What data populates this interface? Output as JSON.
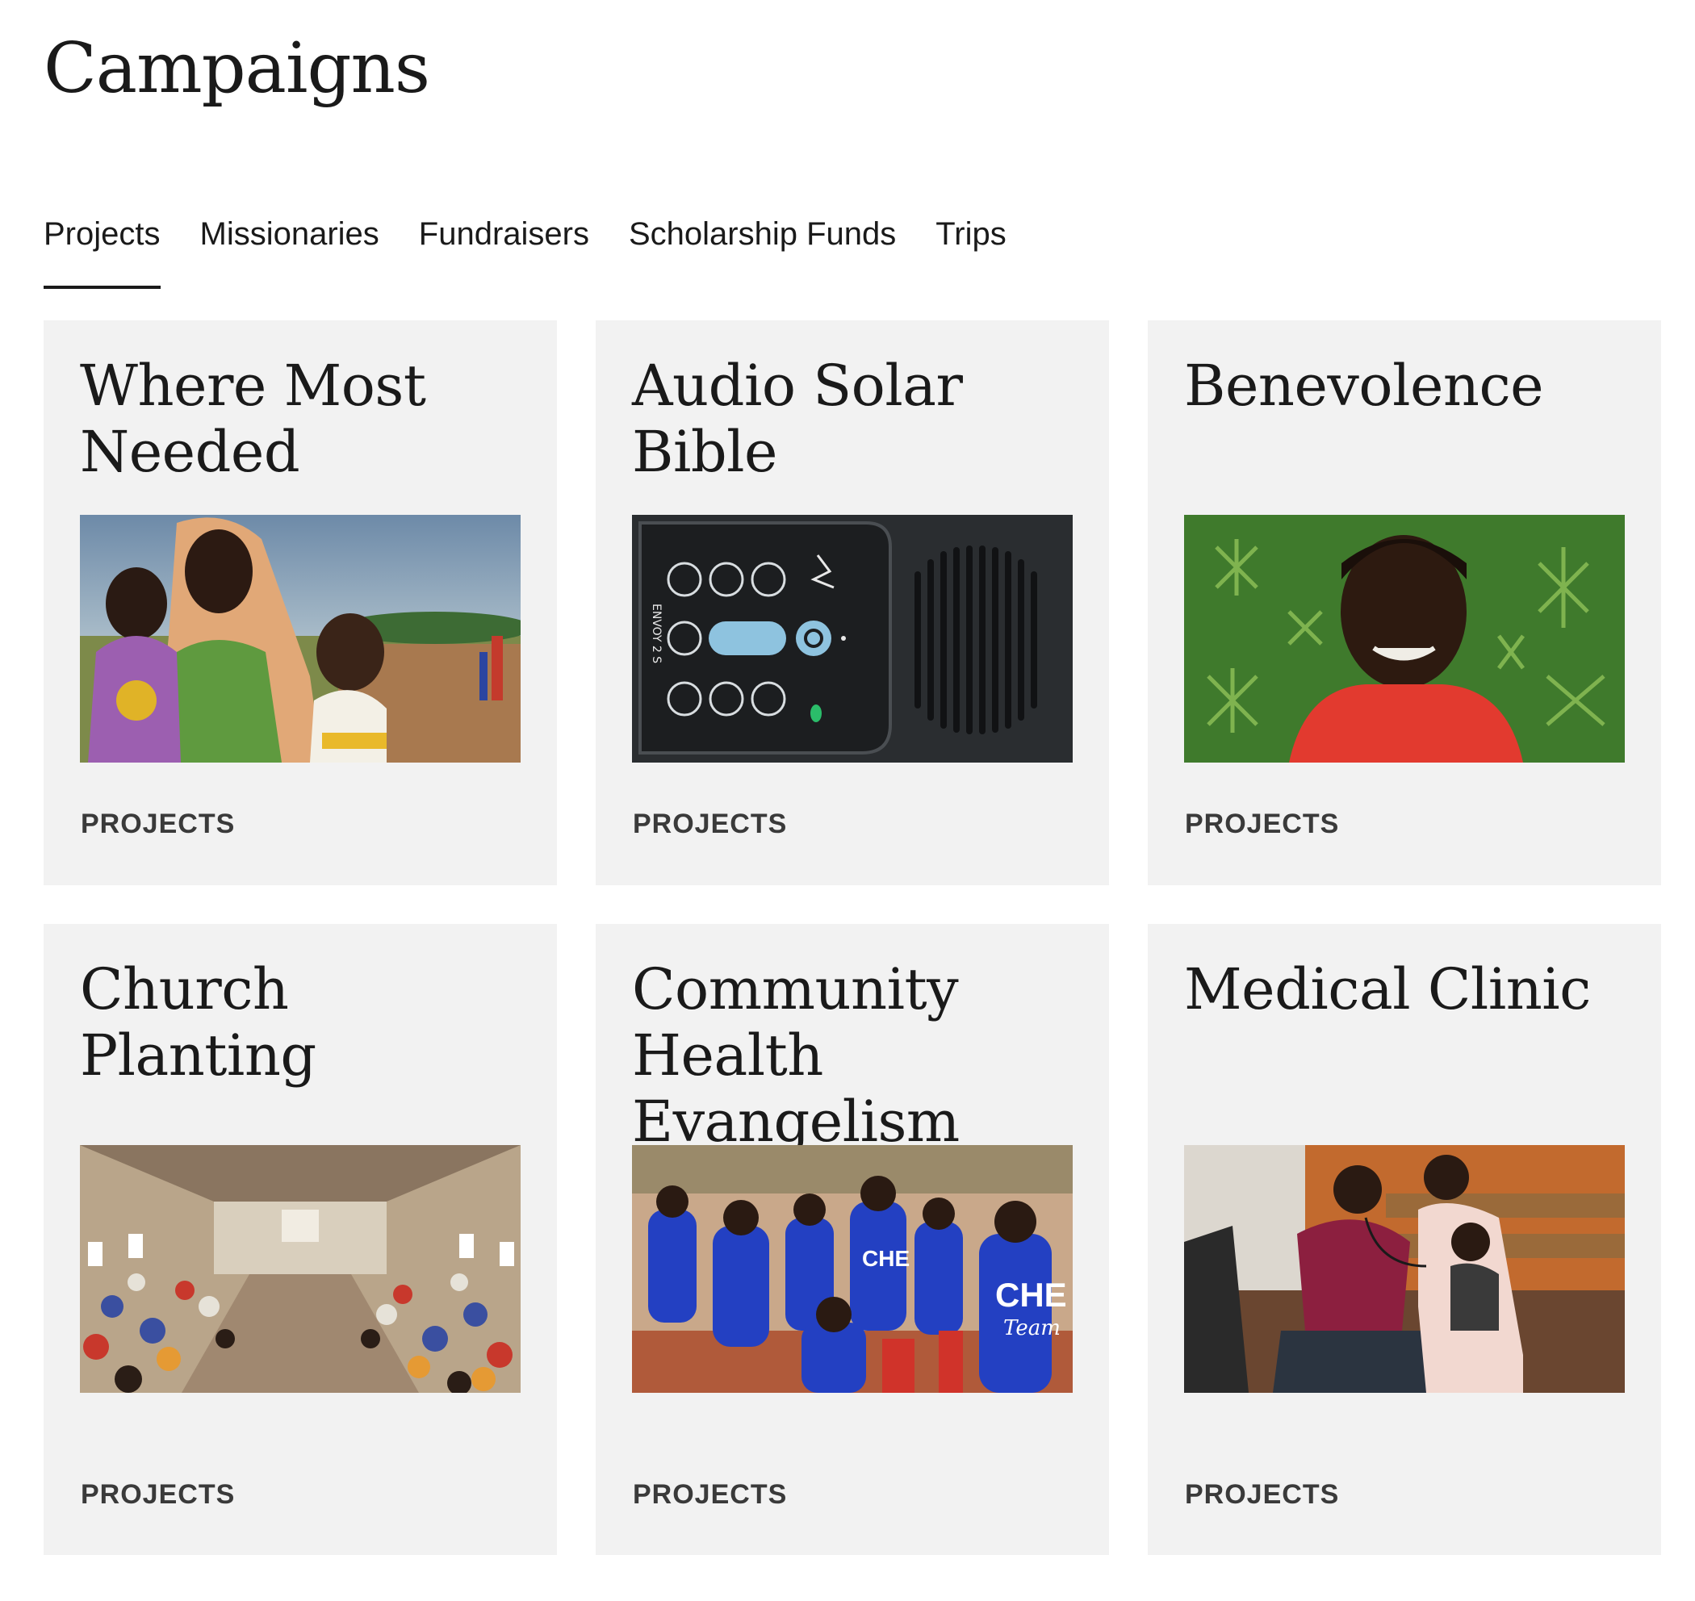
{
  "page": {
    "title": "Campaigns"
  },
  "tabs": [
    {
      "label": "Projects",
      "active": true
    },
    {
      "label": "Missionaries",
      "active": false
    },
    {
      "label": "Fundraisers",
      "active": false
    },
    {
      "label": "Scholarship Funds",
      "active": false
    },
    {
      "label": "Trips",
      "active": false
    }
  ],
  "cards": [
    {
      "title": "Where Most Needed",
      "tag": "PROJECTS",
      "image": "photo-woman-with-two-children"
    },
    {
      "title": "Audio Solar Bible",
      "tag": "PROJECTS",
      "image": "photo-audio-bible-device",
      "device_label": "ENVOY 2 S"
    },
    {
      "title": "Benevolence",
      "tag": "PROJECTS",
      "image": "photo-smiling-child-red-shirt"
    },
    {
      "title": "Church Planting",
      "tag": "PROJECTS",
      "image": "photo-church-congregation"
    },
    {
      "title": "Community Health Evangelism",
      "tag": "PROJECTS",
      "image": "photo-che-team-crowd",
      "shirt_label": "CHE",
      "shirt_sub": "Team"
    },
    {
      "title": "Medical Clinic",
      "tag": "PROJECTS",
      "image": "photo-doctor-examining-baby"
    }
  ],
  "colors": {
    "card_background": "#f2f2f2",
    "text": "#1a1a1a",
    "tag_text": "#3a3a3a",
    "active_underline": "#1a1a1a"
  }
}
